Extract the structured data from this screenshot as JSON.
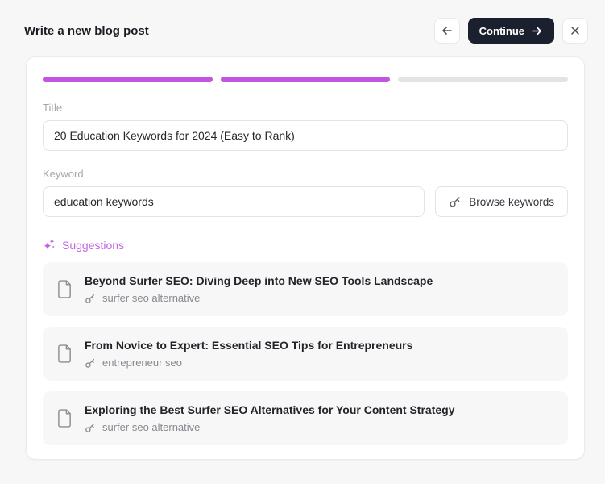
{
  "colors": {
    "accent_purple": "#c155e0",
    "progress_empty": "#e4e4e7",
    "dark_button": "#1a202e",
    "panel_bg": "#ffffff",
    "page_bg": "#f7f7f8",
    "card_bg": "#f7f7f8"
  },
  "header": {
    "title": "Write a new blog post",
    "back_icon": "arrow-left-icon",
    "continue_label": "Continue",
    "continue_icon": "arrow-right-icon",
    "close_icon": "close-icon"
  },
  "progress": {
    "completed": 2,
    "total": 3,
    "segments": [
      "filled",
      "filled",
      "empty"
    ]
  },
  "form": {
    "title_label": "Title",
    "title_value": "20 Education Keywords for 2024 (Easy to Rank)",
    "keyword_label": "Keyword",
    "keyword_value": "education keywords",
    "browse_button_label": "Browse keywords",
    "browse_button_icon": "key-icon"
  },
  "suggestions": {
    "header_label": "Suggestions",
    "header_icon": "sparkles-icon",
    "item_icon": "document-icon",
    "keyword_icon": "key-icon",
    "items": [
      {
        "title": "Beyond Surfer SEO: Diving Deep into New SEO Tools Landscape",
        "keyword": "surfer seo alternative"
      },
      {
        "title": "From Novice to Expert: Essential SEO Tips for Entrepreneurs",
        "keyword": "entrepreneur seo"
      },
      {
        "title": "Exploring the Best Surfer SEO Alternatives for Your Content Strategy",
        "keyword": "surfer seo alternative"
      }
    ]
  }
}
